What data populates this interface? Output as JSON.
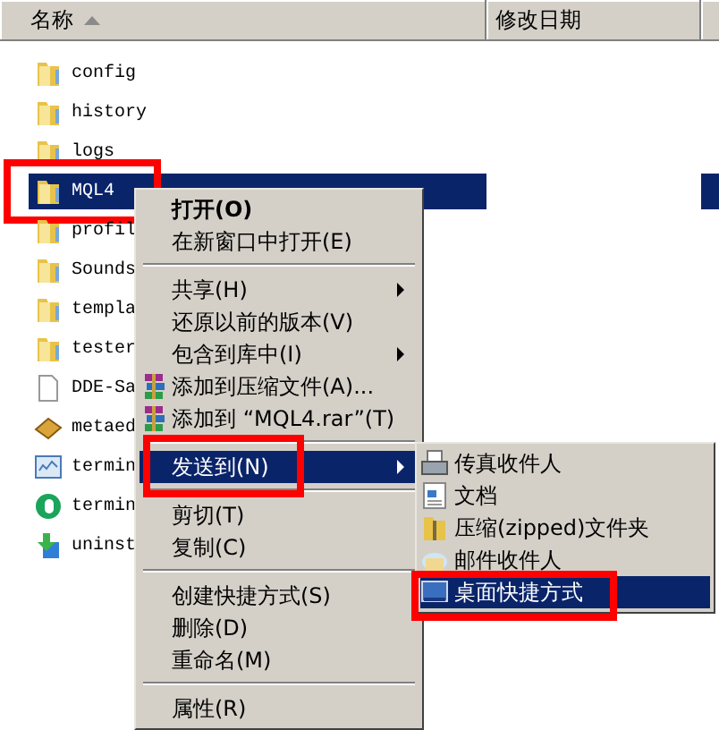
{
  "columns": [
    {
      "label": "名称",
      "sorted": true
    },
    {
      "label": "修改日期",
      "sorted": false
    }
  ],
  "files": [
    {
      "name": "config",
      "kind": "folder",
      "selected": false,
      "highlighted": false
    },
    {
      "name": "history",
      "kind": "folder",
      "selected": false,
      "highlighted": false
    },
    {
      "name": "logs",
      "kind": "folder",
      "selected": false,
      "highlighted": false
    },
    {
      "name": "MQL4",
      "kind": "folder",
      "selected": true,
      "highlighted": true
    },
    {
      "name": "profil",
      "kind": "folder",
      "selected": false,
      "highlighted": false
    },
    {
      "name": "Sounds",
      "kind": "folder",
      "selected": false,
      "highlighted": false
    },
    {
      "name": "templa",
      "kind": "folder",
      "selected": false,
      "highlighted": false
    },
    {
      "name": "tester",
      "kind": "folder",
      "selected": false,
      "highlighted": false
    },
    {
      "name": "DDE-Sa",
      "kind": "file",
      "selected": false,
      "highlighted": false
    },
    {
      "name": "metaed",
      "kind": "editor",
      "selected": false,
      "highlighted": false
    },
    {
      "name": "termin",
      "kind": "window",
      "selected": false,
      "highlighted": false
    },
    {
      "name": "termin",
      "kind": "app",
      "selected": false,
      "highlighted": false
    },
    {
      "name": "uninst",
      "kind": "installer",
      "selected": false,
      "highlighted": false
    }
  ],
  "context_menu": [
    {
      "kind": "item",
      "label": "打开(O)",
      "bold": true,
      "submenu": false,
      "selected": false,
      "highlighted": false
    },
    {
      "kind": "item",
      "label": "在新窗口中打开(E)",
      "bold": false,
      "submenu": false,
      "selected": false,
      "highlighted": false
    },
    {
      "kind": "separator"
    },
    {
      "kind": "item",
      "label": "共享(H)",
      "bold": false,
      "submenu": true,
      "selected": false,
      "highlighted": false
    },
    {
      "kind": "item",
      "label": "还原以前的版本(V)",
      "bold": false,
      "submenu": false,
      "selected": false,
      "highlighted": false
    },
    {
      "kind": "item",
      "label": "包含到库中(I)",
      "bold": false,
      "submenu": true,
      "selected": false,
      "highlighted": false
    },
    {
      "kind": "archive",
      "label": "添加到压缩文件(A)...",
      "bold": false,
      "submenu": false,
      "selected": false,
      "highlighted": false
    },
    {
      "kind": "archive",
      "label": "添加到 “MQL4.rar”(T)",
      "bold": false,
      "submenu": false,
      "selected": false,
      "highlighted": false
    },
    {
      "kind": "separator"
    },
    {
      "kind": "item",
      "label": "发送到(N)",
      "bold": false,
      "submenu": true,
      "selected": true,
      "highlighted": true
    },
    {
      "kind": "separator"
    },
    {
      "kind": "item",
      "label": "剪切(T)",
      "bold": false,
      "submenu": false,
      "selected": false,
      "highlighted": false
    },
    {
      "kind": "item",
      "label": "复制(C)",
      "bold": false,
      "submenu": false,
      "selected": false,
      "highlighted": false
    },
    {
      "kind": "separator"
    },
    {
      "kind": "item",
      "label": "创建快捷方式(S)",
      "bold": false,
      "submenu": false,
      "selected": false,
      "highlighted": false
    },
    {
      "kind": "item",
      "label": "删除(D)",
      "bold": false,
      "submenu": false,
      "selected": false,
      "highlighted": false
    },
    {
      "kind": "item",
      "label": "重命名(M)",
      "bold": false,
      "submenu": false,
      "selected": false,
      "highlighted": false
    },
    {
      "kind": "separator"
    },
    {
      "kind": "item",
      "label": "属性(R)",
      "bold": false,
      "submenu": false,
      "selected": false,
      "highlighted": false
    }
  ],
  "send_to_menu": [
    {
      "label": "传真收件人",
      "selected": false,
      "highlighted": false
    },
    {
      "label": "文档",
      "selected": false,
      "highlighted": false
    },
    {
      "label": "压缩(zipped)文件夹",
      "selected": false,
      "highlighted": false
    },
    {
      "label": "邮件收件人",
      "selected": false,
      "highlighted": false
    },
    {
      "label": "桌面快捷方式",
      "selected": true,
      "highlighted": true
    }
  ]
}
